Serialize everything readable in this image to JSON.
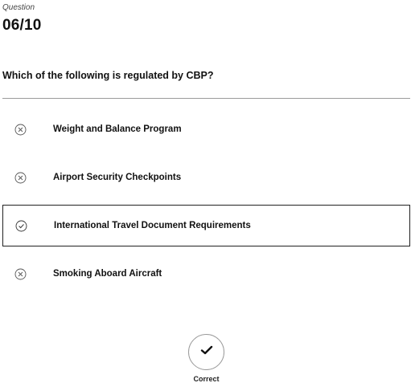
{
  "header": {
    "label": "Question",
    "counter": "06/10"
  },
  "question": {
    "text": "Which of the following is regulated by CBP?"
  },
  "options": [
    {
      "label": "Weight and Balance Program",
      "icon": "circle-x-icon",
      "selected": false
    },
    {
      "label": "Airport Security Checkpoints",
      "icon": "circle-x-icon",
      "selected": false
    },
    {
      "label": "International Travel Document Requirements",
      "icon": "circle-check-icon",
      "selected": true
    },
    {
      "label": "Smoking Aboard Aircraft",
      "icon": "circle-x-icon",
      "selected": false
    }
  ],
  "result": {
    "icon": "checkmark-icon",
    "label": "Correct"
  },
  "colors": {
    "border_selected": "#222222",
    "divider": "#9a9a9a",
    "text": "#111111"
  }
}
